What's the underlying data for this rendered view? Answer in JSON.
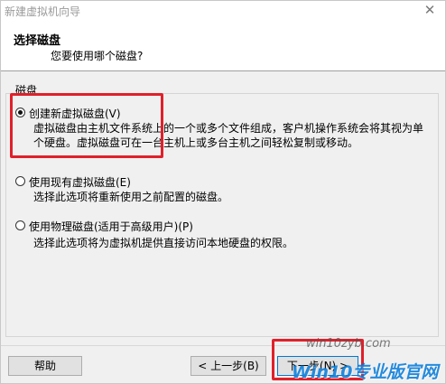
{
  "window": {
    "title": "新建虚拟机向导",
    "close_glyph": "✕"
  },
  "header": {
    "title": "选择磁盘",
    "subtitle": "您要使用哪个磁盘?"
  },
  "group": {
    "label": "磁盘"
  },
  "options": [
    {
      "label": "创建新虚拟磁盘(V)",
      "checked": true,
      "desc_lines": [
        "虚拟磁盘由主机文件系统上的一个或多个文件组成，客户机操作系统会将其视为单",
        "个硬盘。虚拟磁盘可在一台主机上或多台主机之间轻松复制或移动。"
      ]
    },
    {
      "label": "使用现有虚拟磁盘(E)",
      "checked": false,
      "desc_lines": [
        "选择此选项将重新使用之前配置的磁盘。"
      ]
    },
    {
      "label": "使用物理磁盘(适用于高级用户)(P)",
      "checked": false,
      "desc_lines": [
        "选择此选项将为虚拟机提供直接访问本地硬盘的权限。"
      ]
    }
  ],
  "footer": {
    "help_label": "帮助",
    "back_label": "< 上一步(B)",
    "next_label": "下一步(N) >"
  },
  "watermark": {
    "url": "win10zyb.com",
    "brand": "Win10专业版官网"
  },
  "colors": {
    "highlight": "#e0202a",
    "dialog_bg": "#f0f0f0",
    "button_bg": "#e1e1e1",
    "focus_border": "#0078d7"
  }
}
